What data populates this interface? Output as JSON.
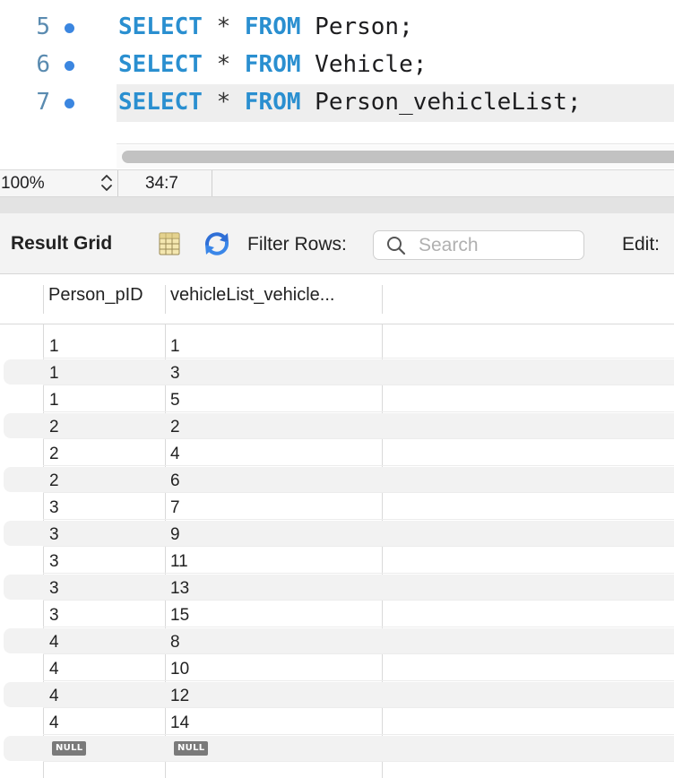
{
  "editor": {
    "lines": [
      {
        "number": "5",
        "tokens": [
          {
            "t": "SELECT",
            "k": "kw"
          },
          {
            "t": " ",
            "k": ""
          },
          {
            "t": "*",
            "k": "op"
          },
          {
            "t": " ",
            "k": ""
          },
          {
            "t": "FROM",
            "k": "kw"
          },
          {
            "t": " Person;",
            "k": ""
          }
        ]
      },
      {
        "number": "6",
        "tokens": [
          {
            "t": "SELECT",
            "k": "kw"
          },
          {
            "t": " ",
            "k": ""
          },
          {
            "t": "*",
            "k": "op"
          },
          {
            "t": " ",
            "k": ""
          },
          {
            "t": "FROM",
            "k": "kw"
          },
          {
            "t": " Vehicle;",
            "k": ""
          }
        ]
      },
      {
        "number": "7",
        "tokens": [
          {
            "t": "SELECT",
            "k": "kw"
          },
          {
            "t": " ",
            "k": ""
          },
          {
            "t": "*",
            "k": "op"
          },
          {
            "t": " ",
            "k": ""
          },
          {
            "t": "FROM",
            "k": "kw"
          },
          {
            "t": " Person_vehicleList;",
            "k": ""
          }
        ]
      }
    ],
    "current_line_index": 2
  },
  "status": {
    "zoom": "100%",
    "cursor_position": "34:7"
  },
  "toolbar": {
    "title": "Result Grid",
    "filter_label": "Filter Rows:",
    "search_placeholder": "Search",
    "search_value": "",
    "edit_label": "Edit:"
  },
  "grid": {
    "columns": [
      "Person_pID",
      "vehicleList_vehicle..."
    ],
    "rows": [
      [
        "1",
        "1"
      ],
      [
        "1",
        "3"
      ],
      [
        "1",
        "5"
      ],
      [
        "2",
        "2"
      ],
      [
        "2",
        "4"
      ],
      [
        "2",
        "6"
      ],
      [
        "3",
        "7"
      ],
      [
        "3",
        "9"
      ],
      [
        "3",
        "11"
      ],
      [
        "3",
        "13"
      ],
      [
        "3",
        "15"
      ],
      [
        "4",
        "8"
      ],
      [
        "4",
        "10"
      ],
      [
        "4",
        "12"
      ],
      [
        "4",
        "14"
      ],
      [
        "NULL",
        "NULL"
      ]
    ],
    "null_label": "NULL"
  },
  "colors": {
    "keyword": "#2a8fd0",
    "line_number": "#5a8bb0",
    "breakpoint": "#3b86e0",
    "current_line": "#eeeeee"
  },
  "icons": {
    "grid": "grid-view-icon",
    "refresh": "refresh-icon",
    "search": "search-icon",
    "zoom_arrows": "chevron-updown-icon"
  }
}
